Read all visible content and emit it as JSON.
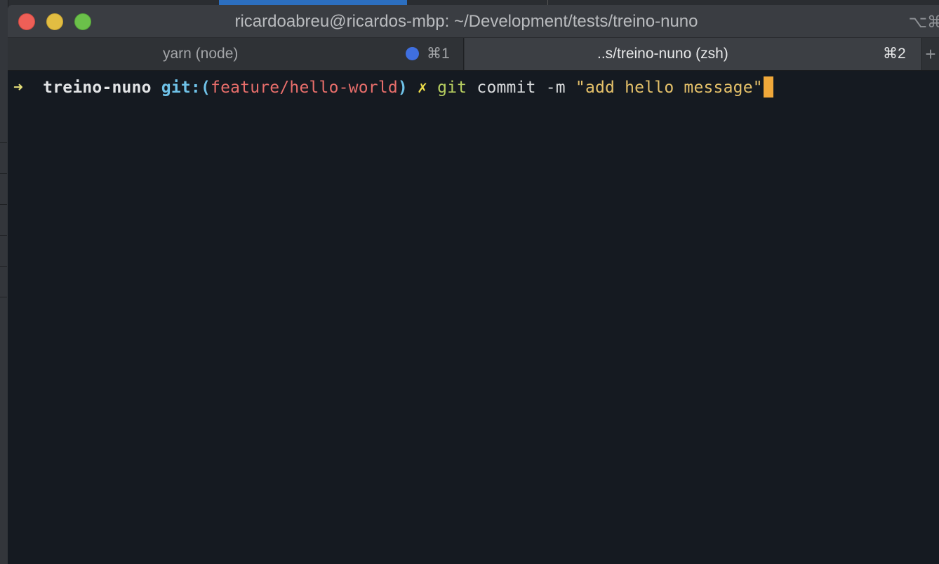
{
  "window": {
    "title": "ricardoabreu@ricardos-mbp: ~/Development/tests/treino-nuno",
    "title_shortcut": "⌥⌘"
  },
  "tabs": [
    {
      "label": "yarn (node)",
      "shortcut": "⌘1",
      "active": false,
      "activity_dot_color": "#3f6fe0"
    },
    {
      "label": "..s/treino-nuno (zsh)",
      "shortcut": "⌘2",
      "active": true
    }
  ],
  "new_tab_glyph": "+",
  "terminal": {
    "prompt_arrow": "➜",
    "directory": "treino-nuno",
    "git_prefix": "git:(",
    "branch": "feature/hello-world",
    "git_suffix": ")",
    "dirty_marker": "✗",
    "command": "git",
    "command_args": "commit -m",
    "command_string": "\"add hello message\""
  },
  "colors": {
    "terminal_background": "#151a21",
    "cursor": "#f0a83a",
    "branch": "#e86e6b",
    "git_label": "#6fc2e8",
    "string": "#e5c16a"
  }
}
